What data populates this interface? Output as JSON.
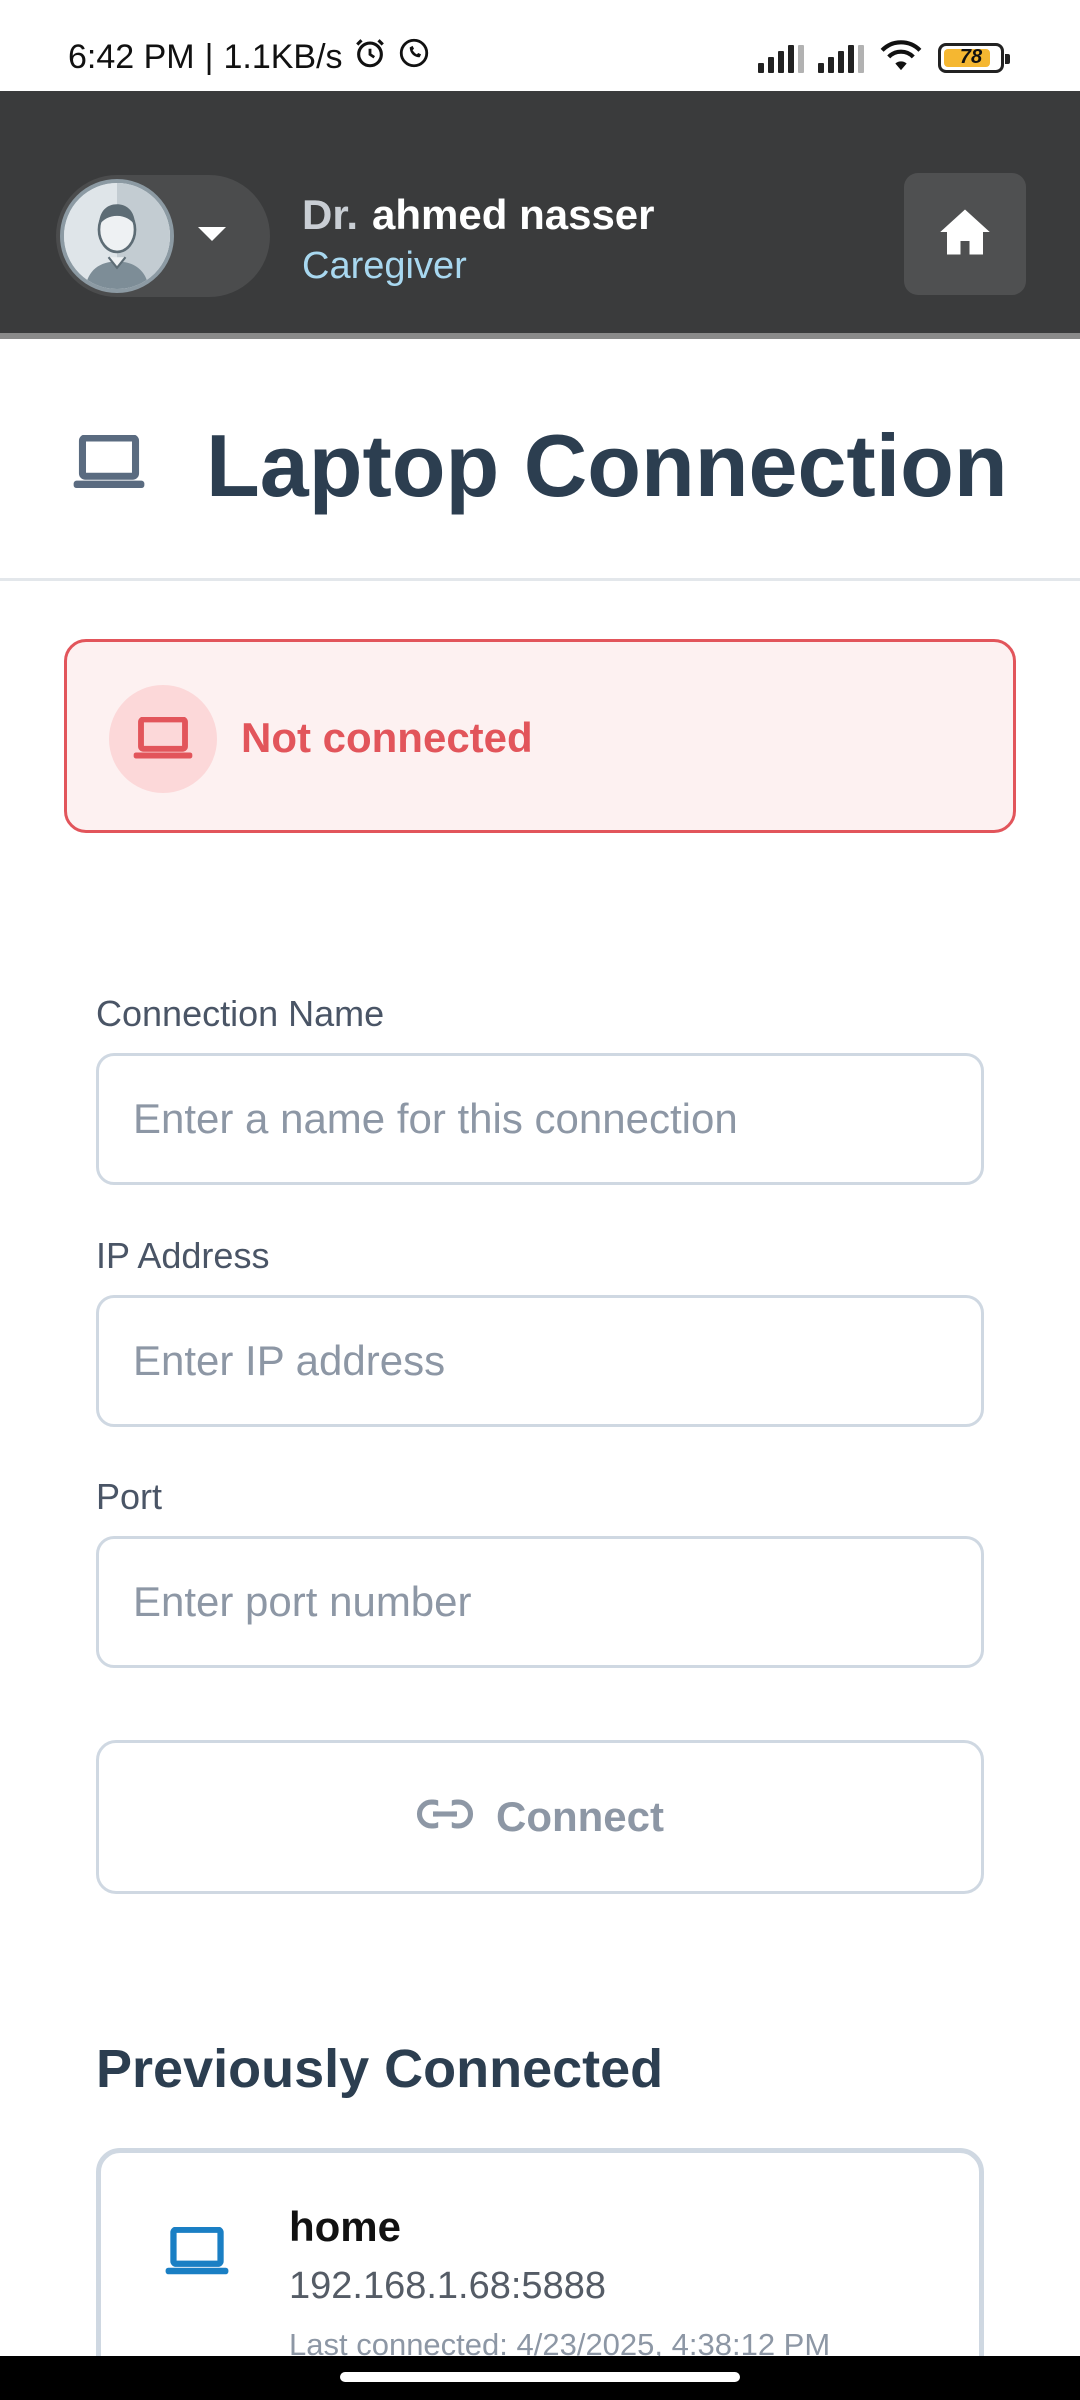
{
  "status_bar": {
    "time": "6:42 PM",
    "network_speed": "1.1KB/s",
    "separator": "|",
    "battery_level": "78",
    "icons": [
      "alarm-icon",
      "whatsapp-icon",
      "signal-icon",
      "signal-icon",
      "wifi-icon",
      "battery-icon"
    ]
  },
  "header": {
    "name_prefix": "Dr.",
    "user_name": "ahmed nasser",
    "role": "Caregiver",
    "icons": [
      "avatar-icon",
      "chevron-down-icon",
      "home-icon"
    ]
  },
  "page": {
    "title": "Laptop Connection",
    "title_icon": "laptop-icon"
  },
  "connection_status": {
    "text": "Not connected",
    "icon": "laptop-icon",
    "color": "#e2555b"
  },
  "form": {
    "name_label": "Connection Name",
    "name_placeholder": "Enter a name for this connection",
    "name_value": "",
    "ip_label": "IP Address",
    "ip_placeholder": "Enter IP address",
    "ip_value": "",
    "port_label": "Port",
    "port_placeholder": "Enter port number",
    "port_value": "",
    "connect_label": "Connect",
    "connect_icon": "link-icon"
  },
  "previous": {
    "heading": "Previously Connected",
    "items": [
      {
        "name": "home",
        "address": "192.168.1.68:5888",
        "last_connected": "Last connected: 4/23/2025, 4:38:12 PM",
        "icon": "laptop-icon"
      }
    ]
  },
  "colors": {
    "header_bg": "#3a3b3c",
    "role_color": "#a8d8f0",
    "title_color": "#2c3e50",
    "accent_blue": "#1a7fc4",
    "error_red": "#e2555b"
  }
}
